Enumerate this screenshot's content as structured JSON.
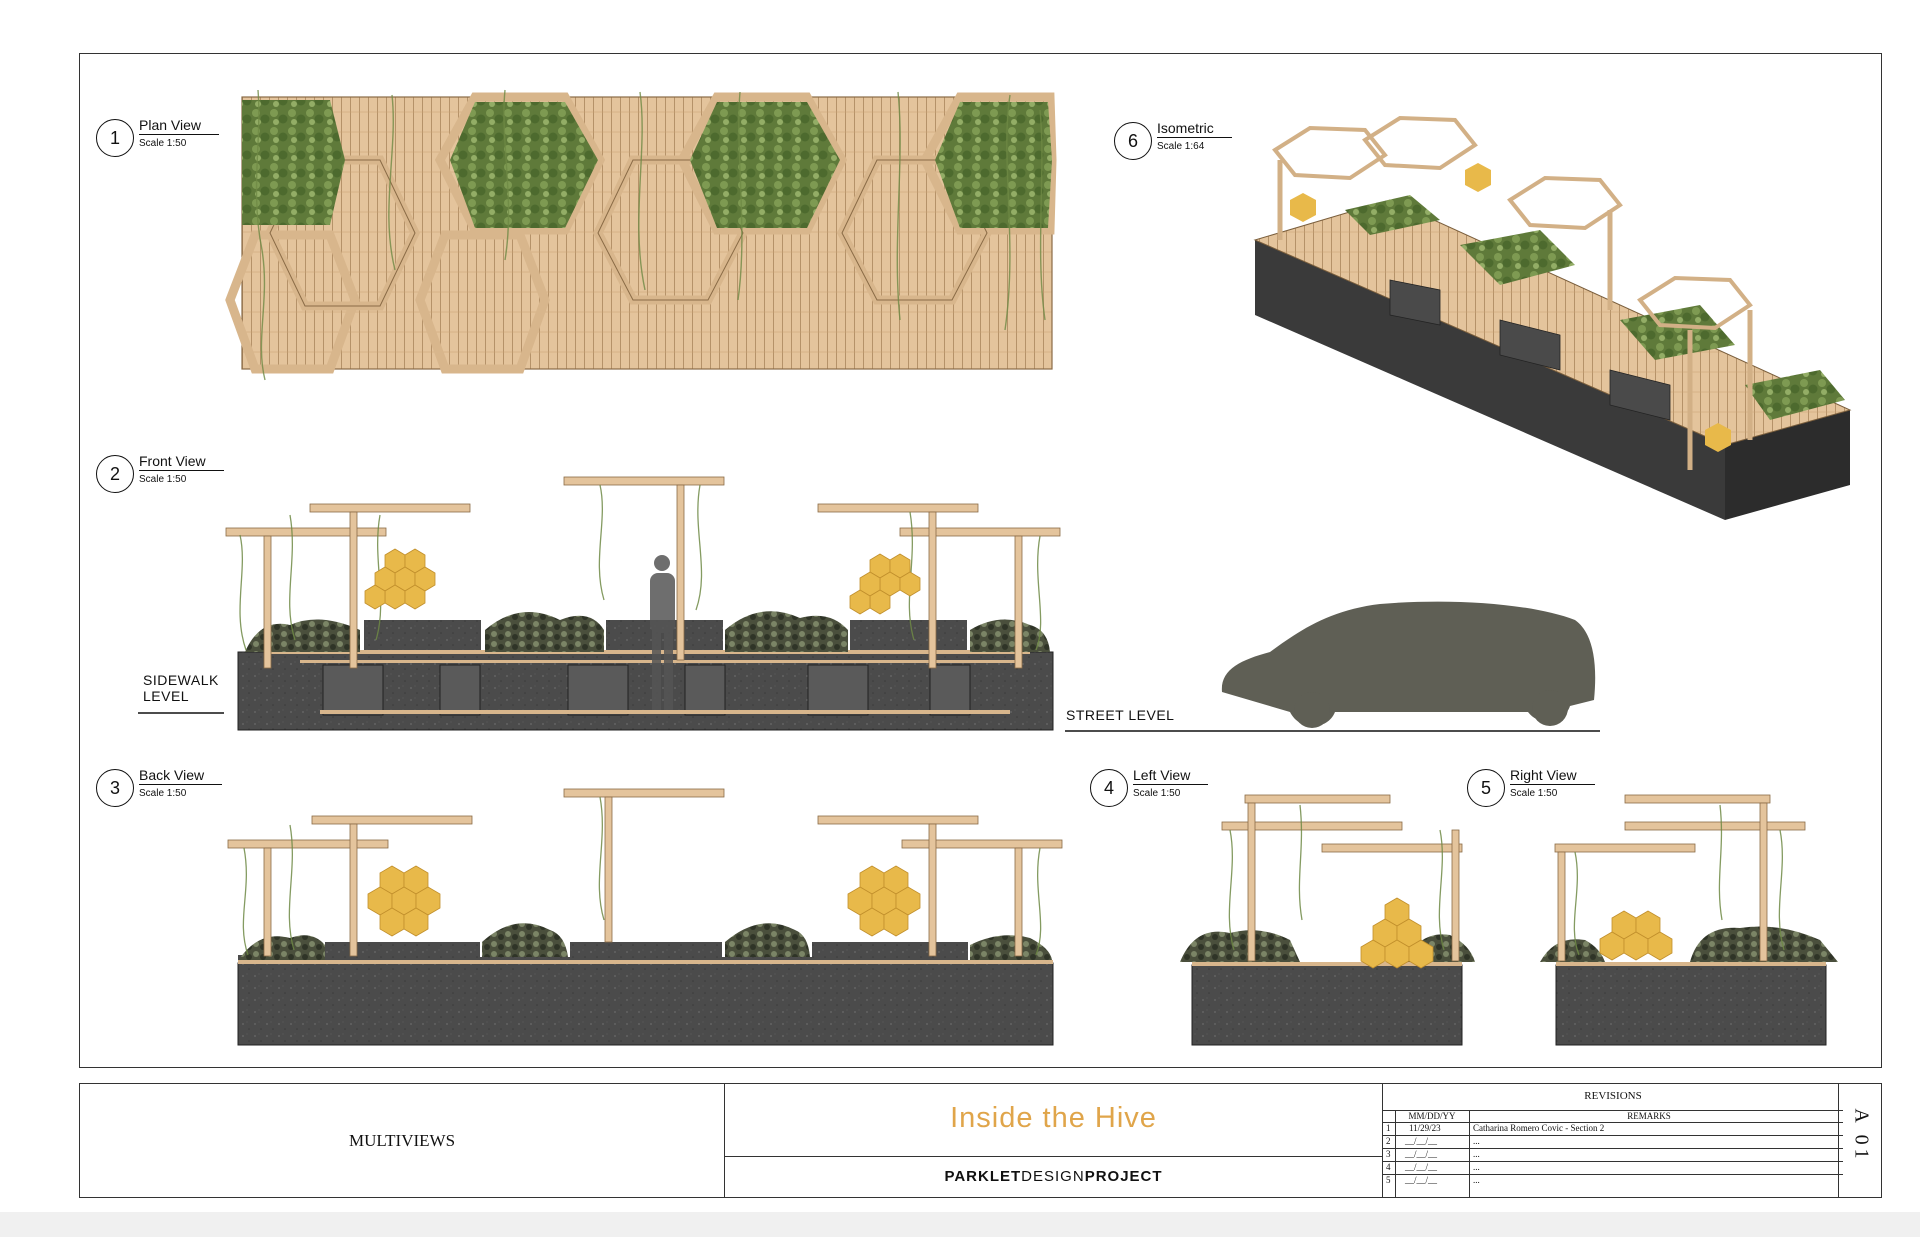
{
  "views": [
    {
      "number": "1",
      "title": "Plan View",
      "scale": "Scale 1:50"
    },
    {
      "number": "2",
      "title": "Front View",
      "scale": "Scale 1:50"
    },
    {
      "number": "3",
      "title": "Back View",
      "scale": "Scale 1:50"
    },
    {
      "number": "4",
      "title": "Left View",
      "scale": "Scale 1:50"
    },
    {
      "number": "5",
      "title": "Right View",
      "scale": "Scale 1:50"
    },
    {
      "number": "6",
      "title": "Isometric",
      "scale": "Scale 1:64"
    }
  ],
  "front_view": {
    "sidewalk_level": "SIDEWALK LEVEL",
    "street_level": "STREET LEVEL",
    "sign_left": "Inside the Hive"
  },
  "title_block": {
    "sheet_title": "MULTIVIEWS",
    "project_title": "Inside the Hive",
    "project_subtitle": {
      "part1": "PARKLET",
      "part2": "DESIGN",
      "part3": "PROJECT"
    },
    "revisions": {
      "heading": "REVISIONS",
      "col_date": "MM/DD/YY",
      "col_remarks": "REMARKS",
      "rows": [
        {
          "num": "1",
          "date": "11/29/23",
          "remarks": "Catharina Romero Covic - Section 2"
        },
        {
          "num": "2",
          "date": "__/__/__",
          "remarks": "..."
        },
        {
          "num": "3",
          "date": "__/__/__",
          "remarks": "..."
        },
        {
          "num": "4",
          "date": "__/__/__",
          "remarks": "..."
        },
        {
          "num": "5",
          "date": "__/__/__",
          "remarks": "..."
        }
      ]
    },
    "sheet_number": "A 01"
  },
  "colors": {
    "wood": "#e4c49c",
    "wood_dark": "#c9a171",
    "concrete": "#4b4b4b",
    "plant": "#6f8a45",
    "hive_yellow": "#e8b94a",
    "car": "#5f5f55",
    "title_orange": "#e0a54a"
  }
}
